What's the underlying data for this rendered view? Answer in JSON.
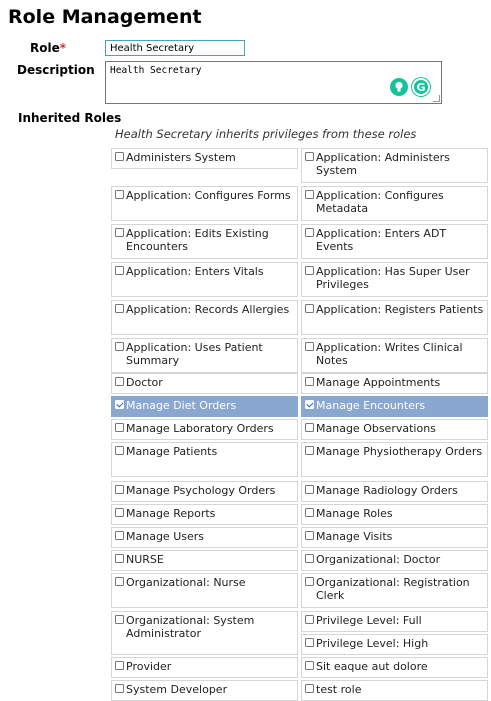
{
  "page": {
    "title": "Role Management"
  },
  "form": {
    "role_label": "Role",
    "required_marker": "*",
    "role_value": "Health Secretary",
    "description_label": "Description",
    "description_value": "Health Secretary",
    "inherited_label": "Inherited Roles",
    "inherit_note": "Health Secretary inherits privileges from these roles"
  },
  "roles": [
    {
      "label": "Administers System",
      "checked": false
    },
    {
      "label": "Application: Administers System",
      "checked": false
    },
    {
      "label": "Application: Configures Forms",
      "checked": false
    },
    {
      "label": "Application: Configures Metadata",
      "checked": false
    },
    {
      "label": "Application: Edits Existing Encounters",
      "checked": false
    },
    {
      "label": "Application: Enters ADT Events",
      "checked": false
    },
    {
      "label": "Application: Enters Vitals",
      "checked": false
    },
    {
      "label": "Application: Has Super User Privileges",
      "checked": false
    },
    {
      "label": "Application: Records Allergies",
      "checked": false
    },
    {
      "label": "Application: Registers Patients",
      "checked": false
    },
    {
      "label": "Application: Uses Patient Summary",
      "checked": false
    },
    {
      "label": "Application: Writes Clinical Notes",
      "checked": false
    },
    {
      "label": "Doctor",
      "checked": false
    },
    {
      "label": "Manage Appointments",
      "checked": false
    },
    {
      "label": "Manage Diet Orders",
      "checked": true
    },
    {
      "label": "Manage Encounters",
      "checked": true
    },
    {
      "label": "Manage Laboratory Orders",
      "checked": false
    },
    {
      "label": "Manage Observations",
      "checked": false
    },
    {
      "label": "Manage Patients",
      "checked": false
    },
    {
      "label": "Manage Physiotherapy Orders",
      "checked": false
    },
    {
      "label": "Manage Psychology Orders",
      "checked": false
    },
    {
      "label": "Manage Radiology Orders",
      "checked": false
    },
    {
      "label": "Manage Reports",
      "checked": false
    },
    {
      "label": "Manage Roles",
      "checked": false
    },
    {
      "label": "Manage Users",
      "checked": false
    },
    {
      "label": "Manage Visits",
      "checked": false
    },
    {
      "label": "NURSE",
      "checked": false
    },
    {
      "label": "Organizational: Doctor",
      "checked": false
    },
    {
      "label": "Organizational: Nurse",
      "checked": false
    },
    {
      "label": "Organizational: Registration Clerk",
      "checked": false
    },
    {
      "label": "Organizational: System Administrator",
      "checked": false
    },
    {
      "label": "Privilege Level: Full",
      "checked": false
    },
    {
      "label": "Privilege Level: High",
      "checked": false
    },
    {
      "label": "Provider",
      "checked": false
    },
    {
      "label": "Sit eaque aut dolore",
      "checked": false
    },
    {
      "label": "System Developer",
      "checked": false
    },
    {
      "label": "test role",
      "checked": false
    }
  ],
  "icons": {
    "grammarly_bulb": "lightbulb-icon",
    "grammarly_logo": "grammarly-g-icon"
  },
  "colors": {
    "checked_bg": "#8aa7cf",
    "required": "#d32f2f",
    "input_border": "#4aa3b8",
    "grammarly": "#15c39a"
  }
}
